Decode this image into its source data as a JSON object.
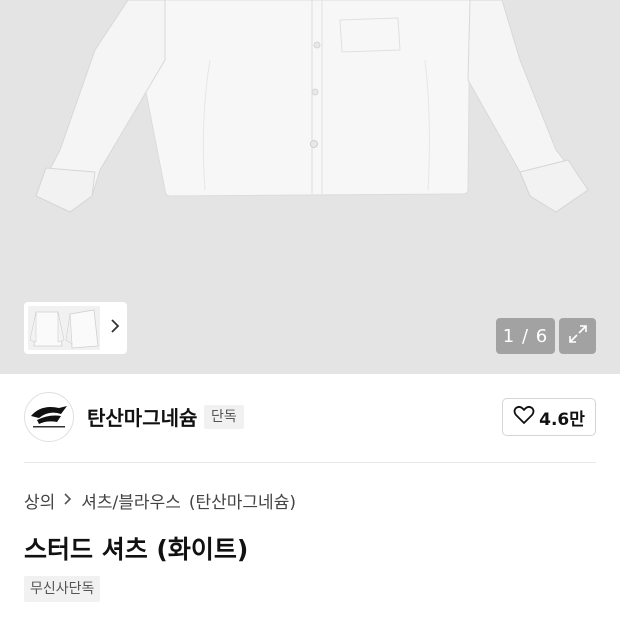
{
  "gallery": {
    "counter": "1 / 6",
    "thumb_arrow_icon": "chevron-right-icon",
    "expand_icon": "expand-icon",
    "background": "#e4e4e4"
  },
  "brand": {
    "name": "탄산마그네슘",
    "badge": "단독",
    "logo_icon": "brand-logo",
    "like_icon": "heart-icon",
    "like_count": "4.6만"
  },
  "breadcrumb": {
    "category": "상의",
    "separator_icon": "chevron-right-icon",
    "subcategory": "셔츠/블라우스",
    "brand": "(탄산마그네슘)"
  },
  "product": {
    "title": "스터드 셔츠 (화이트)",
    "tag": "무신사단독"
  }
}
